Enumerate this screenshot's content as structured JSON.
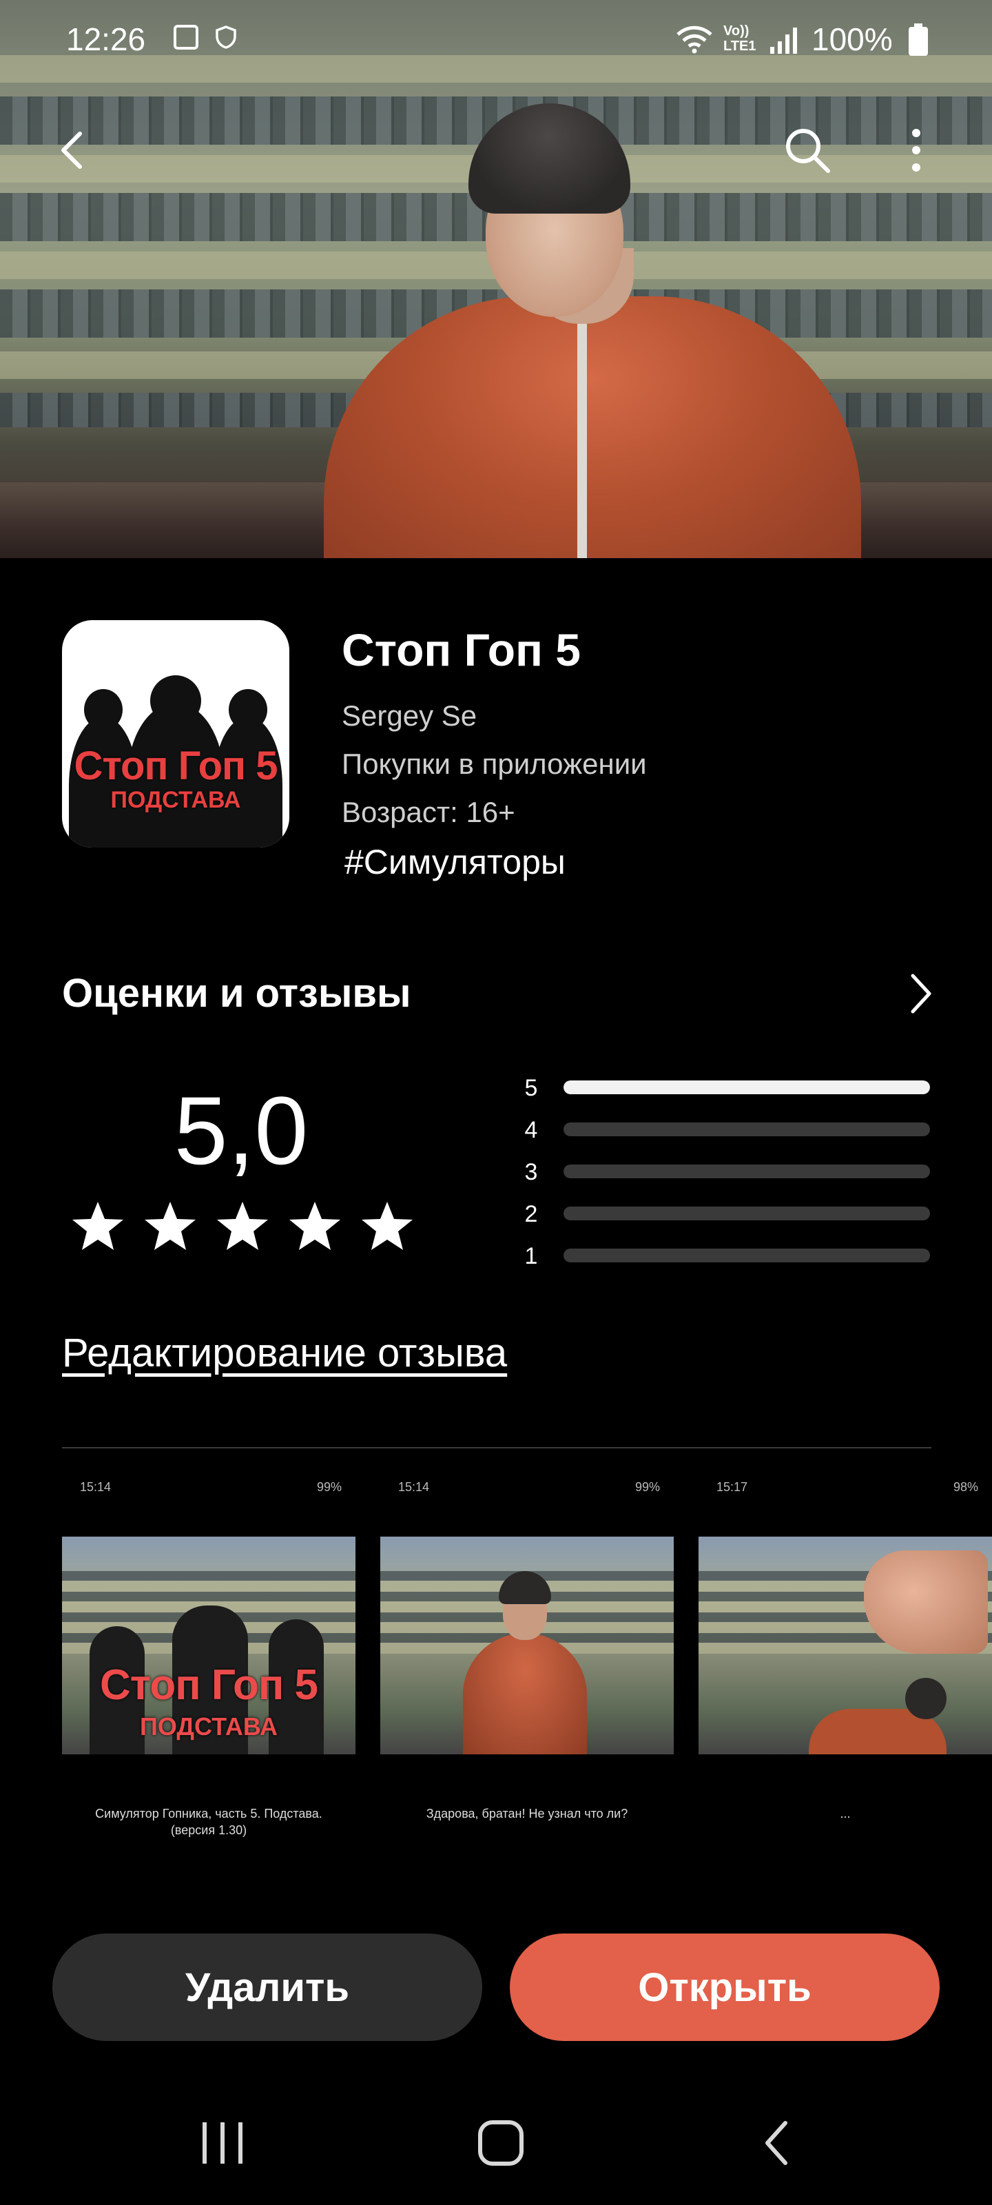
{
  "status_bar": {
    "time": "12:26",
    "network": "Vo)) LTE1",
    "battery": "100%"
  },
  "app": {
    "title": "Стоп Гоп 5",
    "developer": "Sergey Se",
    "in_app": "Покупки в приложении",
    "age": "Возраст: 16+",
    "tag": "#Симуляторы",
    "icon_title": "Стоп Гоп 5",
    "icon_subtitle": "ПОДСТАВА"
  },
  "ratings": {
    "heading": "Оценки и отзывы",
    "score": "5,0",
    "stars": 5,
    "distribution": [
      {
        "label": "5",
        "fraction": 1.0
      },
      {
        "label": "4",
        "fraction": 0.0
      },
      {
        "label": "3",
        "fraction": 0.0
      },
      {
        "label": "2",
        "fraction": 0.0
      },
      {
        "label": "1",
        "fraction": 0.0
      }
    ],
    "edit_review": "Редактирование отзыва"
  },
  "screenshots": [
    {
      "time": "15:14",
      "battery": "99%",
      "title": "Стоп Гоп 5",
      "subtitle": "ПОДСТАВА",
      "caption": "Симулятор Гопника, часть 5. Подстава. (версия 1.30)"
    },
    {
      "time": "15:14",
      "battery": "99%",
      "caption": "Здарова, братан! Не узнал что ли?"
    },
    {
      "time": "15:17",
      "battery": "98%",
      "caption": "..."
    }
  ],
  "buttons": {
    "delete": "Удалить",
    "open": "Открыть"
  },
  "colors": {
    "accent": "#e3604a",
    "secondary_button": "#2d2d2d",
    "background": "#000000"
  }
}
